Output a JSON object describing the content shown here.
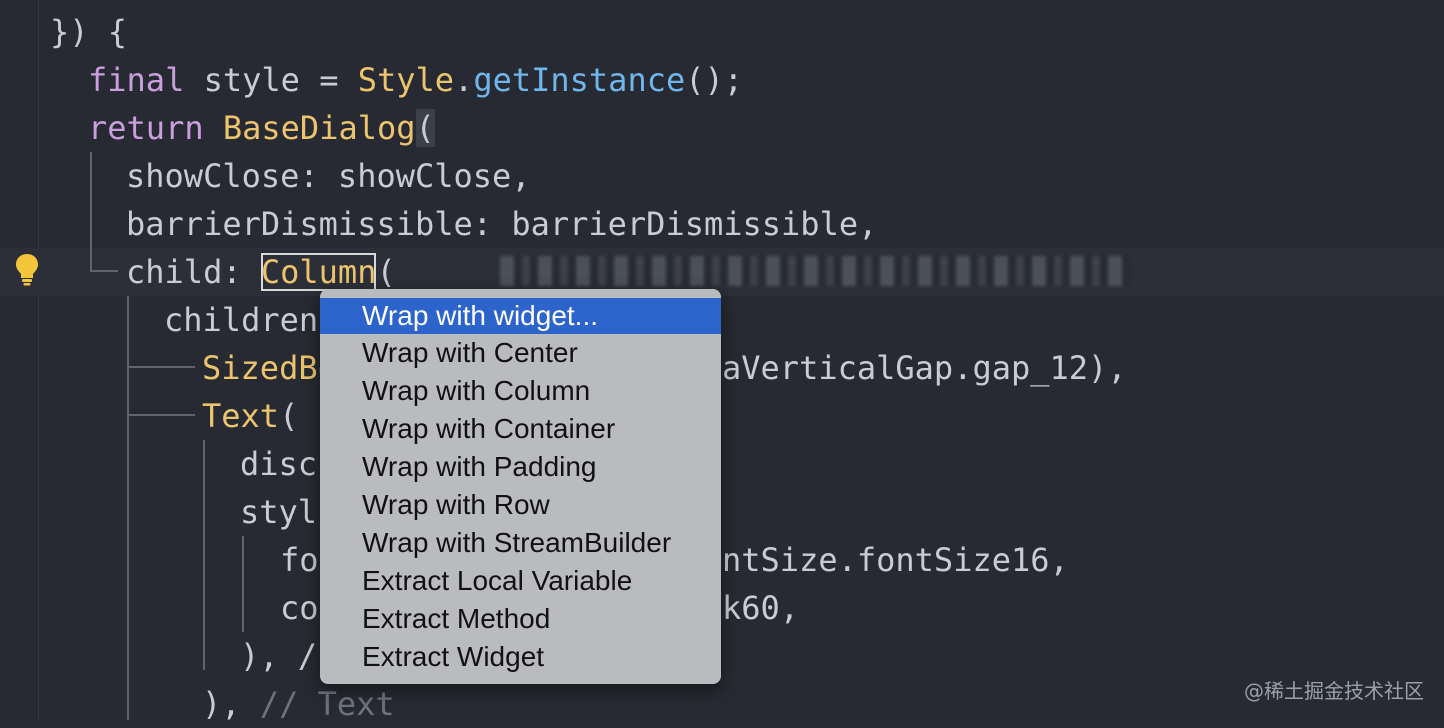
{
  "code": {
    "l0": {
      "t1": "}) {"
    },
    "l1": {
      "kw": "final",
      "t1": " style = ",
      "cls": "Style",
      "t2": ".",
      "fn": "getInstance",
      "t3": "();"
    },
    "l2": {
      "kw": "return",
      "t1": " ",
      "cls": "BaseDialog",
      "paren": "("
    },
    "l3": {
      "t1": "showClose: showClose,"
    },
    "l4": {
      "t1": "barrierDismissible: barrierDismissible,"
    },
    "l5": {
      "t1": "child: ",
      "cls": "Column",
      "paren": "("
    },
    "l6": {
      "t1": "children"
    },
    "l7": {
      "cls": "SizedBo",
      "t1": "aVerticalGap.gap_12),"
    },
    "l8": {
      "cls": "Text",
      "paren": "("
    },
    "l9": {
      "t1": "disc"
    },
    "l10": {
      "t1": "styl"
    },
    "l11": {
      "t1": "fo",
      "t2": "ntSize.fontSize16,"
    },
    "l12": {
      "t1": "co",
      "t2": "k60,"
    },
    "l13": {
      "t1": "), /"
    },
    "l14": {
      "t1": "), ",
      "cm": "// Text"
    }
  },
  "menu": {
    "items": [
      {
        "label": "Wrap with widget..."
      },
      {
        "label": "Wrap with Center"
      },
      {
        "label": "Wrap with Column"
      },
      {
        "label": "Wrap with Container"
      },
      {
        "label": "Wrap with Padding"
      },
      {
        "label": "Wrap with Row"
      },
      {
        "label": "Wrap with StreamBuilder"
      },
      {
        "label": "Extract Local Variable"
      },
      {
        "label": "Extract Method"
      },
      {
        "label": "Extract Widget"
      }
    ],
    "selected_index": 0
  },
  "icons": {
    "bulb": "lightbulb-icon"
  },
  "watermark": "@稀土掘金技术社区",
  "colors": {
    "background": "#272a32",
    "keyword": "#c9a0dc",
    "class": "#ecc46d",
    "function": "#6fb6ea",
    "selection": "#2d64cc"
  }
}
